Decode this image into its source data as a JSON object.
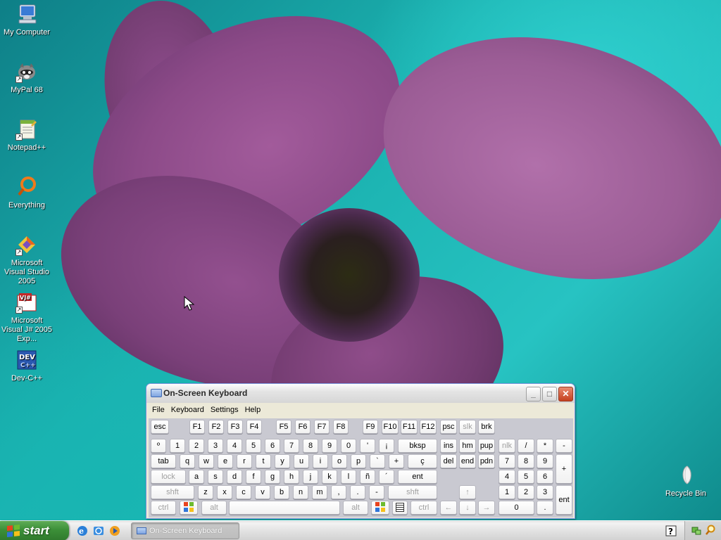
{
  "desktop": {
    "icons": [
      {
        "label": "My Computer"
      },
      {
        "label": "MyPal 68"
      },
      {
        "label": "Notepad++"
      },
      {
        "label": "Everything"
      },
      {
        "label": "Microsoft Visual Studio 2005"
      },
      {
        "label": "Microsoft Visual J# 2005 Exp..."
      },
      {
        "label": "Dev-C++"
      },
      {
        "label": "Recycle Bin"
      }
    ]
  },
  "osk": {
    "title": "On-Screen Keyboard",
    "menu": [
      "File",
      "Keyboard",
      "Settings",
      "Help"
    ],
    "keys": {
      "esc": "esc",
      "f1": "F1",
      "f2": "F2",
      "f3": "F3",
      "f4": "F4",
      "f5": "F5",
      "f6": "F6",
      "f7": "F7",
      "f8": "F8",
      "f9": "F9",
      "f10": "F10",
      "f11": "F11",
      "f12": "F12",
      "psc": "psc",
      "slk": "slk",
      "brk": "brk",
      "num_row": [
        "º",
        "1",
        "2",
        "3",
        "4",
        "5",
        "6",
        "7",
        "8",
        "9",
        "0",
        "'",
        "¡"
      ],
      "bksp": "bksp",
      "ins": "ins",
      "home": "hm",
      "pgup": "pup",
      "nlk": "nlk",
      "kp_div": "/",
      "kp_mul": "*",
      "kp_sub": "-",
      "tab": "tab",
      "q_row": [
        "q",
        "w",
        "e",
        "r",
        "t",
        "y",
        "u",
        "i",
        "o",
        "p",
        "`",
        "+",
        "ç"
      ],
      "del": "del",
      "end": "end",
      "pgdn": "pdn",
      "kp7": "7",
      "kp8": "8",
      "kp9": "9",
      "kp_add": "+",
      "lock": "lock",
      "a_row": [
        "a",
        "s",
        "d",
        "f",
        "g",
        "h",
        "j",
        "k",
        "l",
        "ñ",
        "´"
      ],
      "ent": "ent",
      "kp4": "4",
      "kp5": "5",
      "kp6": "6",
      "shft": "shft",
      "z_row": [
        "z",
        "x",
        "c",
        "v",
        "b",
        "n",
        "m",
        ",",
        ".",
        "-"
      ],
      "up": "↑",
      "kp1": "1",
      "kp2": "2",
      "kp3": "3",
      "kp_ent": "ent",
      "ctrl": "ctrl",
      "alt": "alt",
      "altgr": "alt",
      "left": "←",
      "down": "↓",
      "right": "→",
      "kp0": "0",
      "kp_dot": "."
    }
  },
  "taskbar": {
    "start_label": "start",
    "task_label": "On-Screen Keyboard"
  }
}
